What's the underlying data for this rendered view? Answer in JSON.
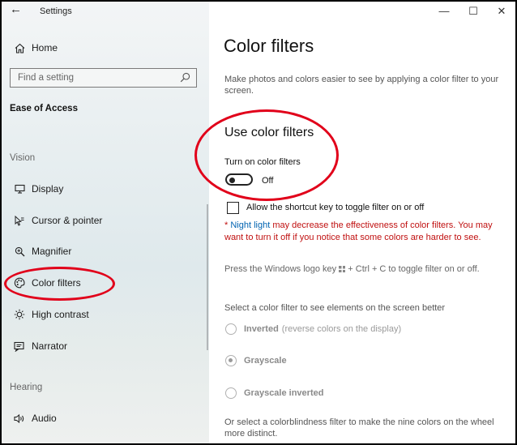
{
  "window": {
    "app_title": "Settings",
    "back_glyph": "←",
    "controls": {
      "minimize": "—",
      "maximize": "☐",
      "close": "✕"
    }
  },
  "sidebar": {
    "home_label": "Home",
    "search_placeholder": "Find a setting",
    "section_title": "Ease of Access",
    "vision_label": "Vision",
    "vision_items": [
      {
        "label": "Display",
        "icon": "display-icon"
      },
      {
        "label": "Cursor & pointer",
        "icon": "cursor-icon"
      },
      {
        "label": "Magnifier",
        "icon": "magnifier-icon"
      },
      {
        "label": "Color filters",
        "icon": "color-palette-icon"
      },
      {
        "label": "High contrast",
        "icon": "brightness-icon"
      },
      {
        "label": "Narrator",
        "icon": "narrator-icon"
      }
    ],
    "hearing_label": "Hearing",
    "hearing_items": [
      {
        "label": "Audio",
        "icon": "speaker-icon"
      }
    ]
  },
  "main": {
    "title": "Color filters",
    "description": "Make photos and colors easier to see by applying a color filter to your screen.",
    "use_heading": "Use color filters",
    "toggle_label": "Turn on color filters",
    "toggle_state": "Off",
    "shortcut_checkbox_label": "Allow the shortcut key to toggle filter on or off",
    "warning_prefix": "* ",
    "warning_link": "Night light",
    "warning_text": "may decrease the effectiveness of color filters. You may want to turn it off if you notice that some colors are harder to see.",
    "hint_before": "Press the Windows logo key",
    "hint_after": "+ Ctrl + C to toggle filter on or off.",
    "select_label": "Select a color filter to see elements on the screen better",
    "filters": [
      {
        "label": "Inverted",
        "note": "(reverse colors on the display)",
        "selected": false
      },
      {
        "label": "Grayscale",
        "note": "",
        "selected": true
      },
      {
        "label": "Grayscale inverted",
        "note": "",
        "selected": false
      }
    ],
    "colorblind_text": "Or select a colorblindness filter to make the nine colors on the wheel more distinct."
  },
  "colors": {
    "annotation": "#e1001a",
    "warning": "#c01010",
    "link": "#0063b1"
  }
}
